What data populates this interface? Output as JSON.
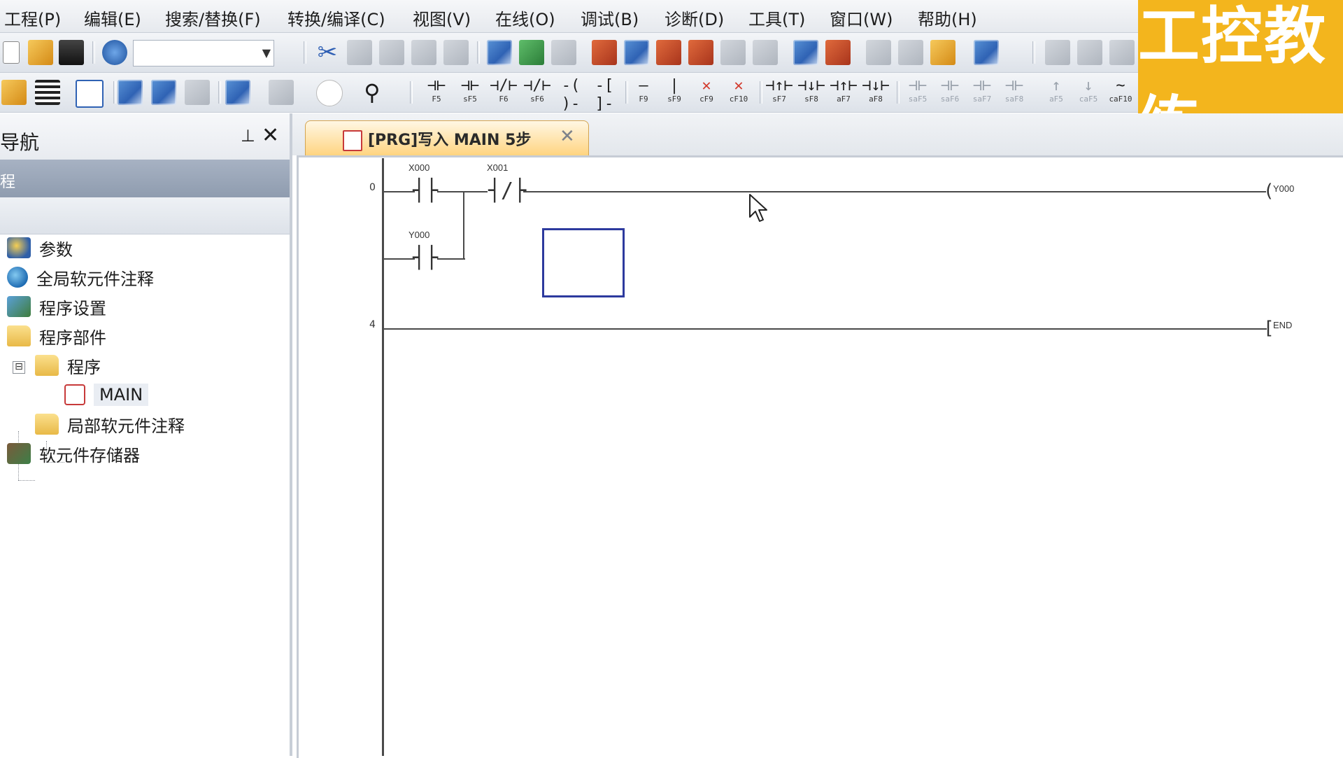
{
  "menu": {
    "items": [
      "工程(P)",
      "编辑(E)",
      "搜索/替换(F)",
      "转换/编译(C)",
      "视图(V)",
      "在线(O)",
      "调试(B)",
      "诊断(D)",
      "工具(T)",
      "窗口(W)",
      "帮助(H)"
    ]
  },
  "toolbar2": {
    "ladder_buttons": [
      {
        "glyph": "⊣⊢",
        "key": "F5"
      },
      {
        "glyph": "⊣⊢",
        "key": "sF5"
      },
      {
        "glyph": "⊣/⊢",
        "key": "F6"
      },
      {
        "glyph": "⊣/⊢",
        "key": "sF6"
      },
      {
        "glyph": "-( )-",
        "key": "F7"
      },
      {
        "glyph": "-[ ]-",
        "key": "F8"
      },
      {
        "glyph": "—",
        "key": "F9"
      },
      {
        "glyph": "|",
        "key": "sF9"
      },
      {
        "glyph": "✕",
        "key": "cF9"
      },
      {
        "glyph": "✕",
        "key": "cF10"
      },
      {
        "glyph": "⊣↑⊢",
        "key": "sF7"
      },
      {
        "glyph": "⊣↓⊢",
        "key": "sF8"
      },
      {
        "glyph": "⊣↑⊢",
        "key": "aF7"
      },
      {
        "glyph": "⊣↓⊢",
        "key": "aF8"
      },
      {
        "glyph": "⊣⊢",
        "key": "saF5"
      },
      {
        "glyph": "⊣⊢",
        "key": "saF6"
      },
      {
        "glyph": "⊣⊢",
        "key": "saF7"
      },
      {
        "glyph": "⊣⊢",
        "key": "saF8"
      },
      {
        "glyph": "↑",
        "key": "aF5"
      },
      {
        "glyph": "↓",
        "key": "caF5"
      },
      {
        "glyph": "~",
        "key": "caF10"
      }
    ]
  },
  "logo": {
    "text": "工控教练",
    "color": "#f3b51d"
  },
  "nav": {
    "title": "导航",
    "pin_icon": "pin-icon",
    "close_icon": "close-icon",
    "close_glyph": "✕",
    "pin_glyph": "⊥",
    "subheader": "程",
    "tree": [
      {
        "label": "参数",
        "icon": "parameter-icon"
      },
      {
        "label": "全局软元件注释",
        "icon": "globe-icon"
      },
      {
        "label": "程序设置",
        "icon": "program-settings-icon"
      },
      {
        "label": "程序部件",
        "icon": "folder-icon"
      },
      {
        "label": "程序",
        "icon": "folder-icon",
        "expander": "⊟"
      },
      {
        "label": "MAIN",
        "icon": "program-file-icon"
      },
      {
        "label": "局部软元件注释",
        "icon": "folder-icon"
      },
      {
        "label": "软元件存储器",
        "icon": "memory-icon"
      }
    ]
  },
  "document_tab": {
    "label": "[PRG]写入 MAIN 5步",
    "close_glyph": "✕",
    "accent_color": "#ffd27a"
  },
  "ladder": {
    "rungs": [
      {
        "step": "0",
        "contacts": [
          {
            "device": "X000",
            "type": "normally-open"
          },
          {
            "device": "X001",
            "type": "normally-closed"
          }
        ],
        "branch_contact": {
          "device": "Y000",
          "type": "normally-open"
        },
        "coil": "Y000"
      },
      {
        "step": "4",
        "instruction": "END"
      }
    ]
  },
  "colors": {
    "cursor_box": "#2d3a9e",
    "rail": "#4a4a4a"
  }
}
